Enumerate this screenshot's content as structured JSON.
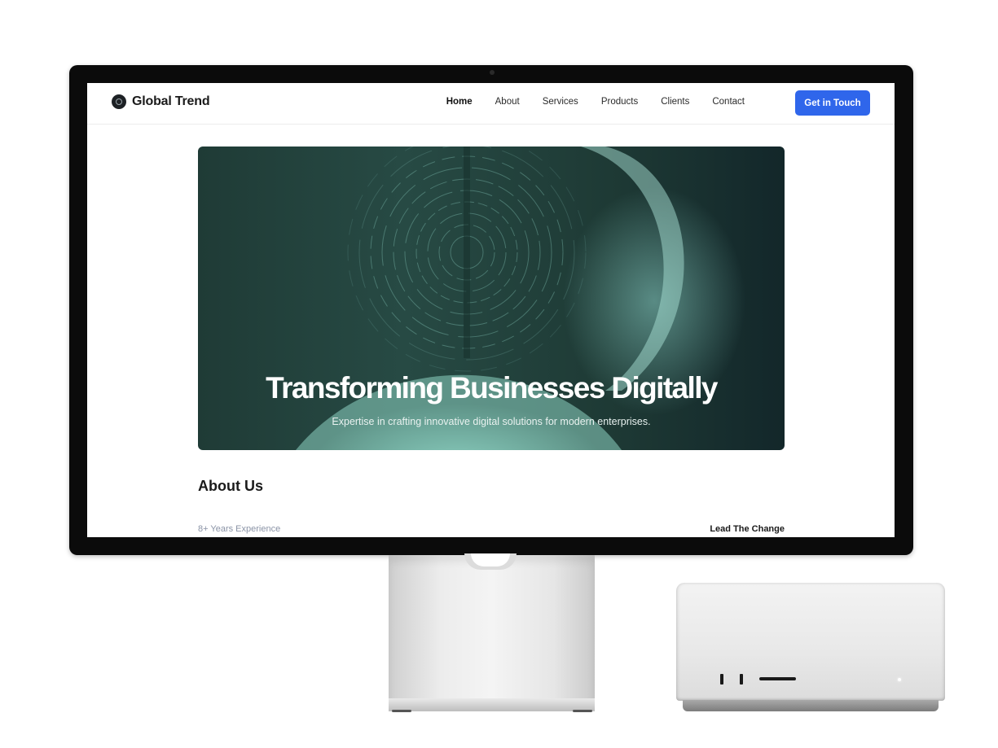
{
  "nav": {
    "brand": "Global Trend",
    "items": [
      {
        "label": "Home",
        "active": true
      },
      {
        "label": "About"
      },
      {
        "label": "Services"
      },
      {
        "label": "Products"
      },
      {
        "label": "Clients"
      },
      {
        "label": "Contact"
      }
    ],
    "cta": "Get in Touch"
  },
  "hero": {
    "title": "Transforming Businesses Digitally",
    "subtitle": "Expertise in crafting innovative digital solutions for modern enterprises."
  },
  "about": {
    "title": "About Us",
    "experience": "8+ Years Experience",
    "tagline": "Lead The Change"
  },
  "colors": {
    "accent": "#2f66eb",
    "hero_dark": "#1f3b36",
    "hero_glow": "#96dccd"
  },
  "icons": {
    "brand_logo": "globe-logo-icon"
  }
}
